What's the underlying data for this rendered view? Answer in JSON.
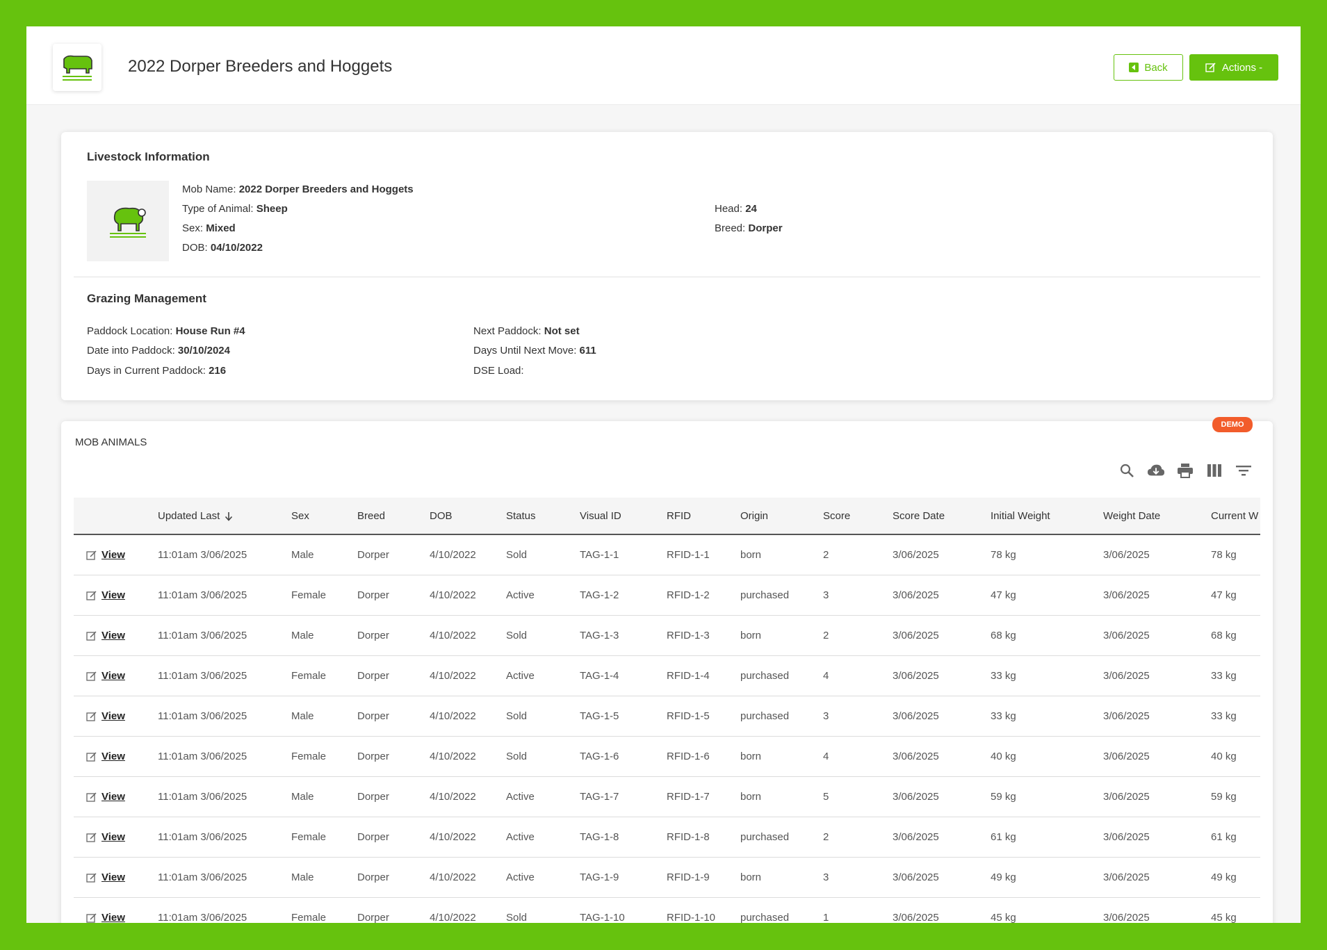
{
  "header": {
    "title": "2022 Dorper Breeders and Hoggets",
    "back_label": "Back",
    "actions_label": "Actions -"
  },
  "livestock": {
    "section_title": "Livestock Information",
    "mob_name_label": "Mob Name:",
    "mob_name": "2022 Dorper Breeders and Hoggets",
    "type_label": "Type of Animal:",
    "type": "Sheep",
    "sex_label": "Sex:",
    "sex": "Mixed",
    "dob_label": "DOB:",
    "dob": "04/10/2022",
    "head_label": "Head:",
    "head": "24",
    "breed_label": "Breed:",
    "breed": "Dorper"
  },
  "grazing": {
    "section_title": "Grazing Management",
    "paddock_label": "Paddock Location:",
    "paddock": "House Run #4",
    "date_into_label": "Date into Paddock:",
    "date_into": "30/10/2024",
    "days_in_label": "Days in Current Paddock:",
    "days_in": "216",
    "next_paddock_label": "Next Paddock:",
    "next_paddock": "Not set",
    "days_until_label": "Days Until Next Move:",
    "days_until": "611",
    "dse_label": "DSE Load:",
    "dse": ""
  },
  "mob_animals": {
    "label": "MOB ANIMALS",
    "badge": "DEMO",
    "tools": [
      "search-icon",
      "cloud-download-icon",
      "print-icon",
      "columns-icon",
      "filter-icon"
    ],
    "columns": [
      "",
      "Updated Last",
      "Sex",
      "Breed",
      "DOB",
      "Status",
      "Visual ID",
      "RFID",
      "Origin",
      "Score",
      "Score Date",
      "Initial Weight",
      "Weight Date",
      "Current W"
    ],
    "view_label": "View",
    "rows": [
      [
        "11:01am 3/06/2025",
        "Male",
        "Dorper",
        "4/10/2022",
        "Sold",
        "TAG-1-1",
        "RFID-1-1",
        "born",
        "2",
        "3/06/2025",
        "78 kg",
        "3/06/2025",
        "78 kg"
      ],
      [
        "11:01am 3/06/2025",
        "Female",
        "Dorper",
        "4/10/2022",
        "Active",
        "TAG-1-2",
        "RFID-1-2",
        "purchased",
        "3",
        "3/06/2025",
        "47 kg",
        "3/06/2025",
        "47 kg"
      ],
      [
        "11:01am 3/06/2025",
        "Male",
        "Dorper",
        "4/10/2022",
        "Sold",
        "TAG-1-3",
        "RFID-1-3",
        "born",
        "2",
        "3/06/2025",
        "68 kg",
        "3/06/2025",
        "68 kg"
      ],
      [
        "11:01am 3/06/2025",
        "Female",
        "Dorper",
        "4/10/2022",
        "Active",
        "TAG-1-4",
        "RFID-1-4",
        "purchased",
        "4",
        "3/06/2025",
        "33 kg",
        "3/06/2025",
        "33 kg"
      ],
      [
        "11:01am 3/06/2025",
        "Male",
        "Dorper",
        "4/10/2022",
        "Sold",
        "TAG-1-5",
        "RFID-1-5",
        "purchased",
        "3",
        "3/06/2025",
        "33 kg",
        "3/06/2025",
        "33 kg"
      ],
      [
        "11:01am 3/06/2025",
        "Female",
        "Dorper",
        "4/10/2022",
        "Sold",
        "TAG-1-6",
        "RFID-1-6",
        "born",
        "4",
        "3/06/2025",
        "40 kg",
        "3/06/2025",
        "40 kg"
      ],
      [
        "11:01am 3/06/2025",
        "Male",
        "Dorper",
        "4/10/2022",
        "Active",
        "TAG-1-7",
        "RFID-1-7",
        "born",
        "5",
        "3/06/2025",
        "59 kg",
        "3/06/2025",
        "59 kg"
      ],
      [
        "11:01am 3/06/2025",
        "Female",
        "Dorper",
        "4/10/2022",
        "Active",
        "TAG-1-8",
        "RFID-1-8",
        "purchased",
        "2",
        "3/06/2025",
        "61 kg",
        "3/06/2025",
        "61 kg"
      ],
      [
        "11:01am 3/06/2025",
        "Male",
        "Dorper",
        "4/10/2022",
        "Active",
        "TAG-1-9",
        "RFID-1-9",
        "born",
        "3",
        "3/06/2025",
        "49 kg",
        "3/06/2025",
        "49 kg"
      ],
      [
        "11:01am 3/06/2025",
        "Female",
        "Dorper",
        "4/10/2022",
        "Sold",
        "TAG-1-10",
        "RFID-1-10",
        "purchased",
        "1",
        "3/06/2025",
        "45 kg",
        "3/06/2025",
        "45 kg"
      ]
    ]
  },
  "colors": {
    "brand": "#66c20e",
    "badge": "#f25c2b"
  }
}
